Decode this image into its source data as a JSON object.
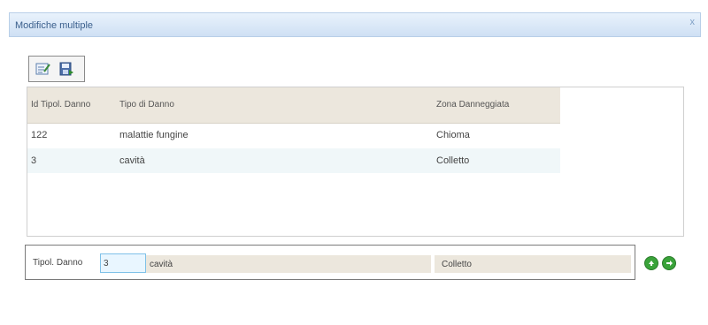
{
  "window": {
    "title": "Modifiche multiple",
    "close_glyph": "x"
  },
  "toolbar": {
    "icons": [
      "edit-list-icon",
      "save-icon"
    ]
  },
  "grid": {
    "columns": [
      "Id Tipol. Danno",
      "Tipo di Danno",
      "Zona Danneggiata"
    ],
    "rows": [
      {
        "id": "122",
        "tipo": "malattie fungine",
        "zona": "Chioma"
      },
      {
        "id": "3",
        "tipo": "cavità",
        "zona": "Colletto"
      }
    ]
  },
  "editor": {
    "label": "Tipol. Danno",
    "id_value": "3",
    "tipo_value": "cavità",
    "zona_value": "Colletto"
  },
  "colors": {
    "title_bar": "#cfe0f4",
    "header_bg": "#ece7dd",
    "alt_row": "#f0f7f9",
    "button_green": "#3aa33a"
  }
}
